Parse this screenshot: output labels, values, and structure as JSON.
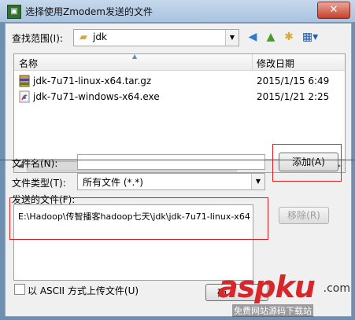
{
  "window": {
    "title": "选择使用Zmodem发送的文件",
    "close_label": "✕"
  },
  "lookin": {
    "label": "查找范围(I):",
    "value": "jdk"
  },
  "file_list": {
    "col_name": "名称",
    "col_date": "修改日期",
    "rows": [
      {
        "name": "jdk-7u71-linux-x64.tar.gz",
        "date": "2015/1/15 6:49",
        "icon": "archive-icon"
      },
      {
        "name": "jdk-7u71-windows-x64.exe",
        "date": "2015/1/21 2:25",
        "icon": "exe-icon"
      }
    ]
  },
  "filename": {
    "label": "文件名(N):",
    "value": ""
  },
  "filetype": {
    "label": "文件类型(T):",
    "value": "所有文件 (*.*)"
  },
  "buttons": {
    "add": "添加(A)",
    "remove": "移除(R)",
    "ok": "确"
  },
  "send_files": {
    "label": "发送的文件(F):",
    "items": [
      "E:\\Hadoop\\传智播客hadoop七天\\jdk\\jdk-7u71-linux-x64.tar.gz"
    ]
  },
  "ascii_option": {
    "label": "以 ASCII 方式上传文件(U)"
  },
  "watermark": {
    "brand": "aspku",
    "domain": ".com",
    "tagline": "免费网站源码下载站"
  },
  "colors": {
    "accent_red": "#e02020",
    "title_bar": "#b9cfe7"
  }
}
